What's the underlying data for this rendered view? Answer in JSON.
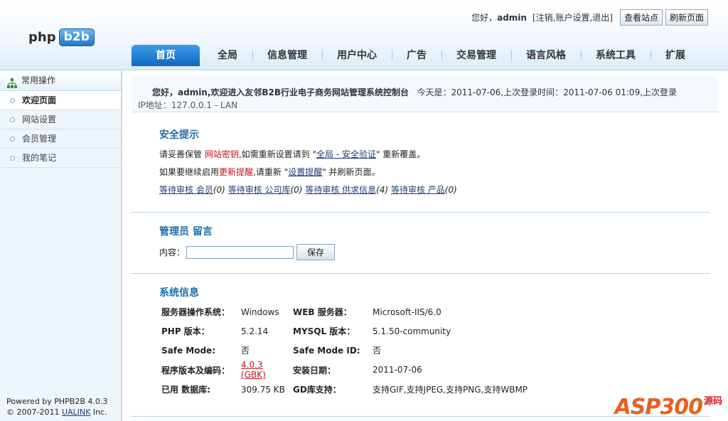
{
  "header": {
    "logo_php": "php",
    "logo_b2b": "b2b",
    "greeting": "您好，",
    "username": "admin",
    "links": "[注销,账户设置,退出]",
    "view_site_btn": "查看站点",
    "refresh_btn": "刷新页面"
  },
  "nav": {
    "tabs": [
      "首页",
      "全局",
      "信息管理",
      "用户中心",
      "广告",
      "交易管理",
      "语言风格",
      "系统工具",
      "扩展"
    ],
    "active": "首页"
  },
  "sidebar": {
    "heading": "常用操作",
    "items": [
      "欢迎页面",
      "网站设置",
      "会员管理",
      "我的笔记"
    ],
    "active": "欢迎页面",
    "powered_line": "Powered by PHPB2B 4.0.3",
    "copyright_prefix": "© 2007-2011 ",
    "company_link": "UALINK",
    "copyright_suffix": " Inc."
  },
  "welcome": {
    "greeting": "您好，admin,欢迎进入友邻B2B行业电子商务网站管理系统控制台",
    "login_info": "今天是：2011-07-06,上次登录时间：2011-07-06 01:09,上次登录",
    "ip_line": "IP地址：127.0.0.1 - LAN"
  },
  "security": {
    "title": "安全提示",
    "line1_prefix": "请妥善保管 ",
    "line1_key": "网站密钥",
    "line1_mid": ",如需重新设置请到 \"",
    "line1_link": "全局 - 安全验证",
    "line1_suffix": "\" 重新覆盖。",
    "line2_prefix": "如果要继续启用",
    "line2_red": "更新提醒",
    "line2_mid": ",请重新 \"",
    "line2_link": "设置提醒",
    "line2_suffix": "\" 并刷新页面。",
    "pending": [
      {
        "label": "等待审核 会员",
        "count": "(0)"
      },
      {
        "label": "等待审核 公司库",
        "count": "(0)"
      },
      {
        "label": "等待审核 供求信息",
        "count": "(4)"
      },
      {
        "label": "等待审核 产品",
        "count": "(0)"
      }
    ]
  },
  "note": {
    "title": "管理员 留言",
    "label": "内容：",
    "value": "",
    "save_btn": "保存"
  },
  "sysinfo": {
    "title": "系统信息",
    "rows": [
      {
        "k1": "服务器操作系统：",
        "v1": "Windows",
        "k2": "WEB 服务器：",
        "v2": "Microsoft-IIS/6.0"
      },
      {
        "k1": "PHP 版本：",
        "v1": "5.2.14",
        "k2": "MYSQL 版本：",
        "v2": "5.1.50-community"
      },
      {
        "k1": "Safe Mode:",
        "v1": "否",
        "k2": "Safe Mode ID:",
        "v2": "否"
      },
      {
        "k1": "程序版本及编码：",
        "v1": "4.0.3 (GBK)",
        "k2": "安装日期：",
        "v2": "2011-07-06"
      },
      {
        "k1": "已用 数据库:",
        "v1": "309.75 KB",
        "k2": "GD库支持：",
        "v2": "支持GIF,支持JPEG,支持PNG,支持WBMP"
      }
    ]
  },
  "watermark": {
    "text": "ASP300",
    "suffix": "源码"
  },
  "colors": {
    "accent": "#1a6dab",
    "nav_active": "#0f67bf",
    "warning": "#c0111a"
  }
}
